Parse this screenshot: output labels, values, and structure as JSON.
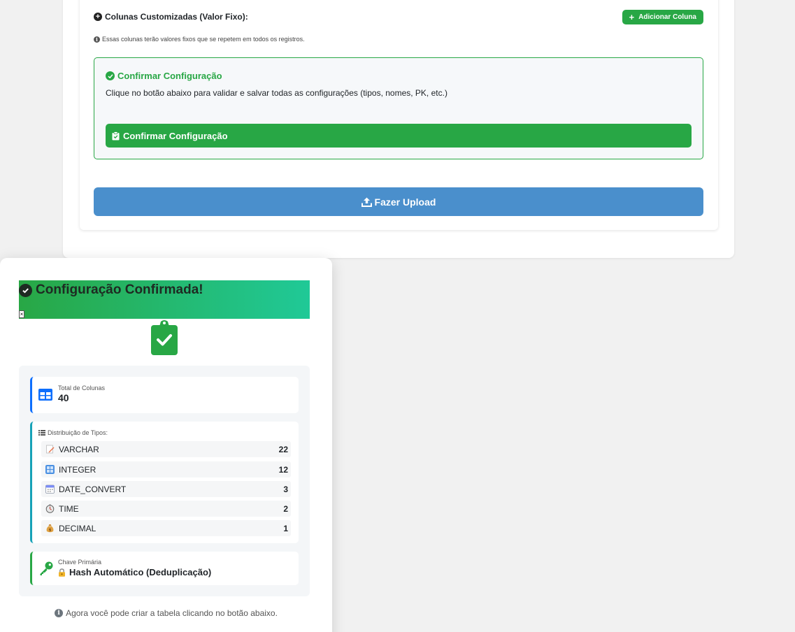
{
  "custom_columns": {
    "title": "Colunas Customizadas (Valor Fixo):",
    "add_button_label": "Adicionar Coluna",
    "info_note": "Essas colunas terão valores fixos que se repetem em todos os registros."
  },
  "confirm_section": {
    "title": "Confirmar Configuração",
    "description": "Clique no botão abaixo para validar e salvar todas as configurações (tipos, nomes, PK, etc.)",
    "button_label": "Confirmar Configuração"
  },
  "upload_button_label": "Fazer Upload",
  "modal": {
    "title": "Configuração Confirmada!",
    "close_label": "×",
    "total_columns": {
      "label": "Total de Colunas",
      "value": "40"
    },
    "type_distribution": {
      "label": "Distribuição de Tipos:",
      "items": [
        {
          "type": "VARCHAR",
          "count": "22",
          "icon": "memo-icon"
        },
        {
          "type": "INTEGER",
          "count": "12",
          "icon": "numbers-icon"
        },
        {
          "type": "DATE_CONVERT",
          "count": "3",
          "icon": "calendar-icon"
        },
        {
          "type": "TIME",
          "count": "2",
          "icon": "stopwatch-icon"
        },
        {
          "type": "DECIMAL",
          "count": "1",
          "icon": "money-bag-icon"
        }
      ]
    },
    "primary_key": {
      "label": "Chave Primária",
      "value": "Hash Automático (Deduplicação)"
    },
    "footer_note": "Agora você pode criar a tabela clicando no botão abaixo."
  },
  "colors": {
    "success": "#28a745",
    "primary": "#0d6efd",
    "info": "#17a2b8",
    "upload": "#4a8fcc"
  }
}
